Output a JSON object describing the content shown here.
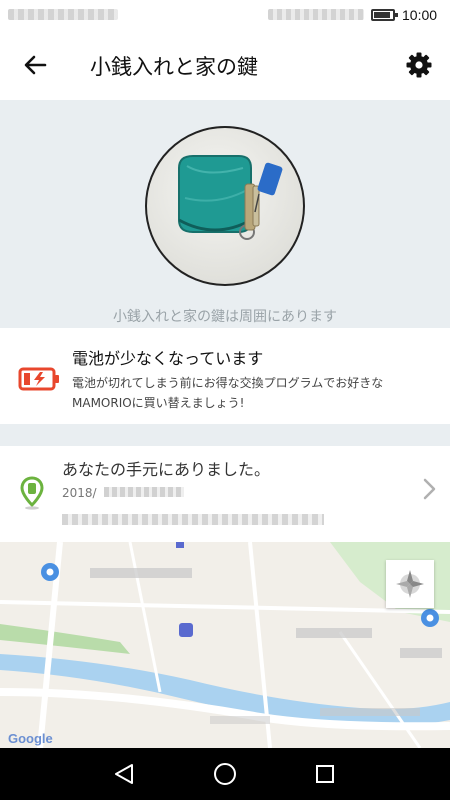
{
  "status_bar": {
    "time": "10:00"
  },
  "header": {
    "title": "小銭入れと家の鍵"
  },
  "hero": {
    "caption": "小銭入れと家の鍵は周囲にあります"
  },
  "battery_notice": {
    "title": "電池が少なくなっています",
    "description": "電池が切れてしまう前にお得な交換プログラムでお好きなMAMORIOに買い替えましょう!"
  },
  "last_location": {
    "title": "あなたの手元にありました。",
    "date_prefix": "2018/"
  },
  "map": {
    "attribution": "Google"
  },
  "colors": {
    "accent_battery": "#e8472d",
    "location_pin": "#6cb33f",
    "background_band": "#e9eef1"
  },
  "icons": {
    "back": "back-arrow-icon",
    "settings": "gear-icon",
    "battery_warning": "battery-low-icon",
    "location": "pin-icon",
    "chevron": "chevron-right-icon",
    "compass": "compass-icon"
  }
}
